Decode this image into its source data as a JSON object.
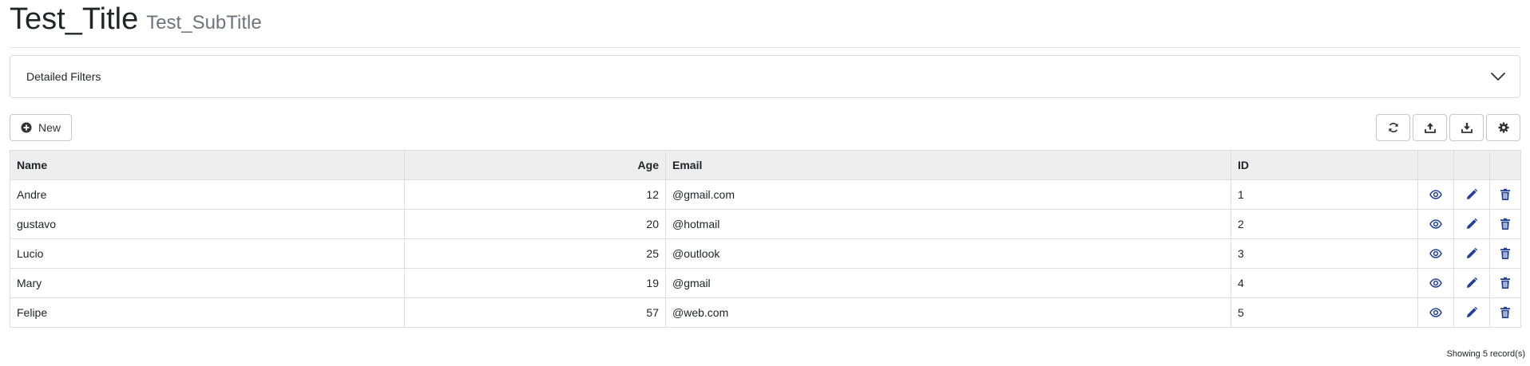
{
  "header": {
    "title": "Test_Title",
    "subtitle": "Test_SubTitle"
  },
  "filters": {
    "label": "Detailed Filters",
    "toggle_icon": "chevron-down-icon"
  },
  "toolbar": {
    "new_label": "New",
    "new_icon": "plus-circle-icon",
    "right_buttons": [
      "refresh-icon",
      "upload-icon",
      "download-icon",
      "gear-icon"
    ]
  },
  "table": {
    "columns": [
      "Name",
      "Age",
      "Email",
      "ID"
    ],
    "rows": [
      {
        "name": "Andre",
        "age": "12",
        "email": "@gmail.com",
        "id": "1"
      },
      {
        "name": "gustavo",
        "age": "20",
        "email": "@hotmail",
        "id": "2"
      },
      {
        "name": "Lucio",
        "age": "25",
        "email": "@outlook",
        "id": "3"
      },
      {
        "name": "Mary",
        "age": "19",
        "email": "@gmail",
        "id": "4"
      },
      {
        "name": "Felipe",
        "age": "57",
        "email": "@web.com",
        "id": "5"
      }
    ],
    "row_actions": [
      "view-icon",
      "edit-icon",
      "delete-icon"
    ]
  },
  "footer": {
    "record_count": "Showing 5 record(s)"
  },
  "colors": {
    "action_icon": "#1f3f99",
    "header_bg": "#eeeeee",
    "border": "#dedede"
  }
}
